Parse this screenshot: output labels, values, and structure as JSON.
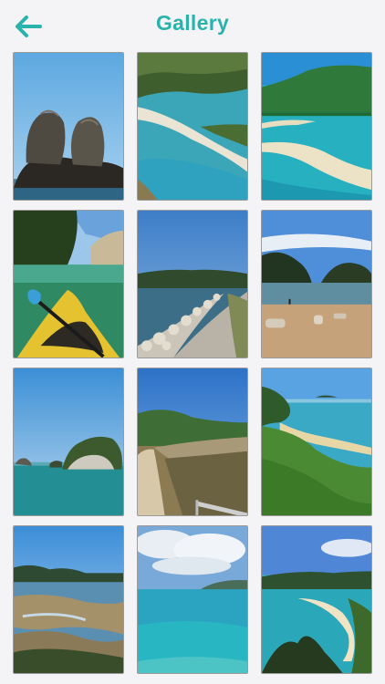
{
  "header": {
    "title": "Gallery",
    "back_icon": "arrow-left-icon"
  },
  "colors": {
    "accent": "#2ab3ad",
    "background": "#f4f4f6",
    "thumb_border": "#9a9a9a"
  },
  "gallery": {
    "photo_count": 12
  }
}
